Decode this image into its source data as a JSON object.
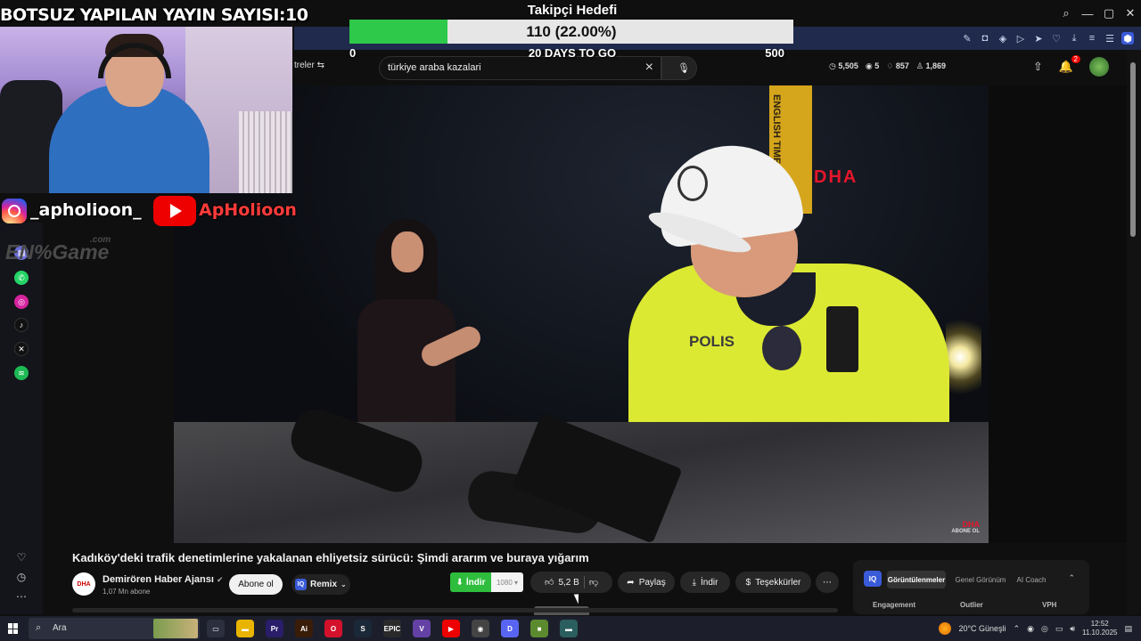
{
  "overlay": {
    "stream_title": "BOTSUZ YAPILAN YAYIN SAYISI:10",
    "goal": {
      "title": "Takipçi Hedefi",
      "progress_text": "110 (22.00%)",
      "progress_fraction": 0.22,
      "min": "0",
      "max": "500",
      "days": "20 DAYS TO GO"
    },
    "social": {
      "instagram": "_apholioon_",
      "youtube": "ApHolioon"
    },
    "watermark": "EN%Game",
    "watermark_suffix": ".com"
  },
  "youtube": {
    "filter_label": "treler",
    "search": {
      "value": "türkiye araba kazalari",
      "clear_icon": "×"
    },
    "stats": [
      "5,505",
      "5",
      "857",
      "1,869"
    ],
    "notifications_count": "2",
    "video": {
      "watermark": "DHA",
      "pole_text": "ENGLISH TIME",
      "badge_text": "POLIS",
      "corner_logo": "DHA",
      "corner_sub": "ABONE OL"
    },
    "video_title": "Kadıköy'deki trafik denetimlerine yakalanan ehliyetsiz sürücü: Şimdi ararım ve buraya yığarım",
    "channel": {
      "avatar": "DHA",
      "name": "Demirören Haber Ajansı",
      "subscribers": "1,07 Mn abone",
      "subscribe_label": "Abone ol",
      "remix_label": "Remix"
    },
    "actions": {
      "download_green": "İndir",
      "resolution": "1080",
      "likes": "5,2 B",
      "share": "Paylaş",
      "download": "İndir",
      "thanks": "Teşekkürler",
      "more": "⋯"
    },
    "analytics": {
      "logo": "IQ",
      "tabs": [
        "Görüntülenmeler",
        "Genel Görünüm",
        "AI Coach"
      ],
      "columns": [
        "Engagement",
        "Outlier",
        "VPH"
      ]
    }
  },
  "taskbar": {
    "search_label": "Ara",
    "weather": "20°C Güneşli",
    "time": "12:52",
    "date": "11.10.2025",
    "apps": [
      {
        "label": "▭",
        "color": "#2b2f3e"
      },
      {
        "label": "▬",
        "color": "#e8b400"
      },
      {
        "label": "Pr",
        "color": "#2a1d6a"
      },
      {
        "label": "Ai",
        "color": "#3a1d08"
      },
      {
        "label": "O",
        "color": "#d3112b"
      },
      {
        "label": "S",
        "color": "#1b2838"
      },
      {
        "label": "EPIC",
        "color": "#2a2a2a"
      },
      {
        "label": "V",
        "color": "#6441a5"
      },
      {
        "label": "▶",
        "color": "#e00"
      },
      {
        "label": "◉",
        "color": "#444"
      },
      {
        "label": "D",
        "color": "#5865f2"
      },
      {
        "label": "■",
        "color": "#5c8a2e"
      },
      {
        "label": "▬",
        "color": "#2b5f5f"
      }
    ]
  },
  "colors": {
    "goal_fill": "#2ec84a",
    "download_green": "#2ebd3c",
    "accent_blue": "#3a5bd8"
  }
}
